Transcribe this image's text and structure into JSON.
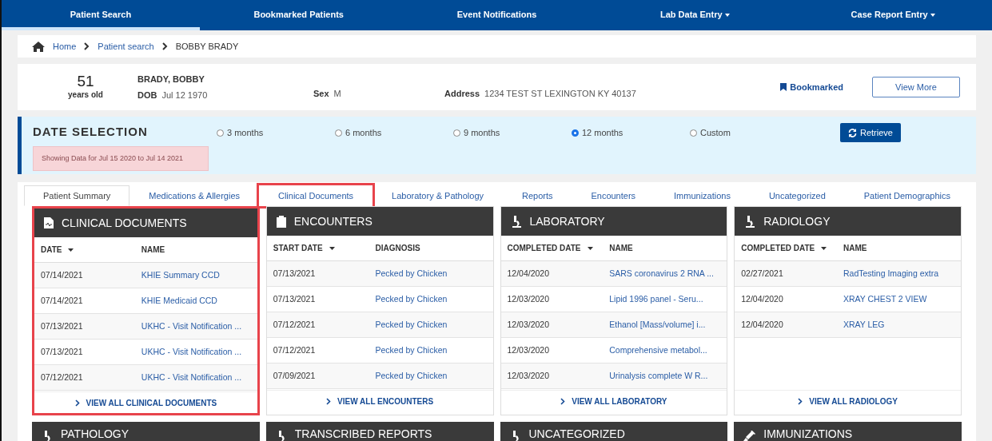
{
  "nav": [
    {
      "label": "Patient Search",
      "selected": true,
      "dropdown": false
    },
    {
      "label": "Bookmarked Patients",
      "selected": false,
      "dropdown": false
    },
    {
      "label": "Event Notifications",
      "selected": false,
      "dropdown": false
    },
    {
      "label": "Lab Data Entry",
      "selected": false,
      "dropdown": true
    },
    {
      "label": "Case Report Entry",
      "selected": false,
      "dropdown": true
    }
  ],
  "breadcrumb": [
    "Home",
    "Patient search",
    "BOBBY BRADY"
  ],
  "patient": {
    "age": "51",
    "age_unit": "years old",
    "name": "BRADY, BOBBY",
    "dob_label": "DOB",
    "dob": "Jul 12 1970",
    "sex_label": "Sex",
    "sex": "M",
    "address_label": "Address",
    "address": "1234 TEST ST LEXINGTON KY 40137",
    "bookmark": "Bookmarked",
    "view_more": "View More"
  },
  "date_selection": {
    "title": "DATE SELECTION",
    "range_notice": "Showing Data for Jul 15 2020 to Jul 14 2021",
    "options": [
      {
        "label": "3 months",
        "selected": false
      },
      {
        "label": "6 months",
        "selected": false
      },
      {
        "label": "9 months",
        "selected": false
      },
      {
        "label": "12 months",
        "selected": true
      },
      {
        "label": "Custom",
        "selected": false
      }
    ],
    "retrieve": "Retrieve"
  },
  "tabs": [
    {
      "label": "Patient Summary",
      "selected": true,
      "highlighted": false
    },
    {
      "label": "Medications & Allergies",
      "selected": false,
      "highlighted": false
    },
    {
      "label": "Clinical Documents",
      "selected": false,
      "highlighted": true
    },
    {
      "label": "Laboratory & Pathology",
      "selected": false,
      "highlighted": false
    },
    {
      "label": "Reports",
      "selected": false,
      "highlighted": false
    },
    {
      "label": "Encounters",
      "selected": false,
      "highlighted": false
    },
    {
      "label": "Immunizations",
      "selected": false,
      "highlighted": false
    },
    {
      "label": "Uncategorized",
      "selected": false,
      "highlighted": false
    },
    {
      "label": "Patient Demographics",
      "selected": false,
      "highlighted": false
    }
  ],
  "panels": [
    {
      "title": "CLINICAL DOCUMENTS",
      "kind": "document",
      "highlighted": true,
      "columns": [
        "DATE",
        "NAME"
      ],
      "rows": [
        [
          "07/14/2021",
          "KHIE Summary CCD"
        ],
        [
          "07/14/2021",
          "KHIE Medicaid CCD"
        ],
        [
          "07/13/2021",
          "UKHC - Visit Notification ..."
        ],
        [
          "07/13/2021",
          "UKHC - Visit Notification ..."
        ],
        [
          "07/12/2021",
          "UKHC - Visit Notification ..."
        ]
      ],
      "footer": "VIEW ALL CLINICAL DOCUMENTS"
    },
    {
      "title": "ENCOUNTERS",
      "kind": "clipboard",
      "highlighted": false,
      "columns": [
        "START DATE",
        "DIAGNOSIS"
      ],
      "rows": [
        [
          "07/13/2021",
          "Pecked by Chicken"
        ],
        [
          "07/13/2021",
          "Pecked by Chicken"
        ],
        [
          "07/12/2021",
          "Pecked by Chicken"
        ],
        [
          "07/12/2021",
          "Pecked by Chicken"
        ],
        [
          "07/09/2021",
          "Pecked by Chicken"
        ]
      ],
      "footer": "VIEW ALL ENCOUNTERS"
    },
    {
      "title": "LABORATORY",
      "kind": "microscope",
      "highlighted": false,
      "columns": [
        "COMPLETED DATE",
        "NAME"
      ],
      "rows": [
        [
          "12/04/2020",
          "SARS coronavirus 2 RNA ..."
        ],
        [
          "12/03/2020",
          "Lipid 1996 panel - Seru..."
        ],
        [
          "12/03/2020",
          "Ethanol [Mass/volume] i..."
        ],
        [
          "12/03/2020",
          "Comprehensive metabol..."
        ],
        [
          "12/03/2020",
          "Urinalysis complete W R..."
        ]
      ],
      "footer": "VIEW ALL LABORATORY"
    },
    {
      "title": "RADIOLOGY",
      "kind": "microscope",
      "highlighted": false,
      "columns": [
        "COMPLETED DATE",
        "NAME"
      ],
      "rows": [
        [
          "02/27/2021",
          "RadTesting Imaging extra"
        ],
        [
          "12/04/2020",
          "XRAY CHEST 2 VIEW"
        ],
        [
          "12/04/2020",
          "XRAY LEG"
        ]
      ],
      "footer": "VIEW ALL RADIOLOGY"
    }
  ],
  "lower_panels": [
    {
      "title": "PATHOLOGY",
      "kind": "microscope"
    },
    {
      "title": "TRANSCRIBED REPORTS",
      "kind": "microscope"
    },
    {
      "title": "UNCATEGORIZED",
      "kind": "microscope"
    },
    {
      "title": "IMMUNIZATIONS",
      "kind": "syringe"
    }
  ]
}
